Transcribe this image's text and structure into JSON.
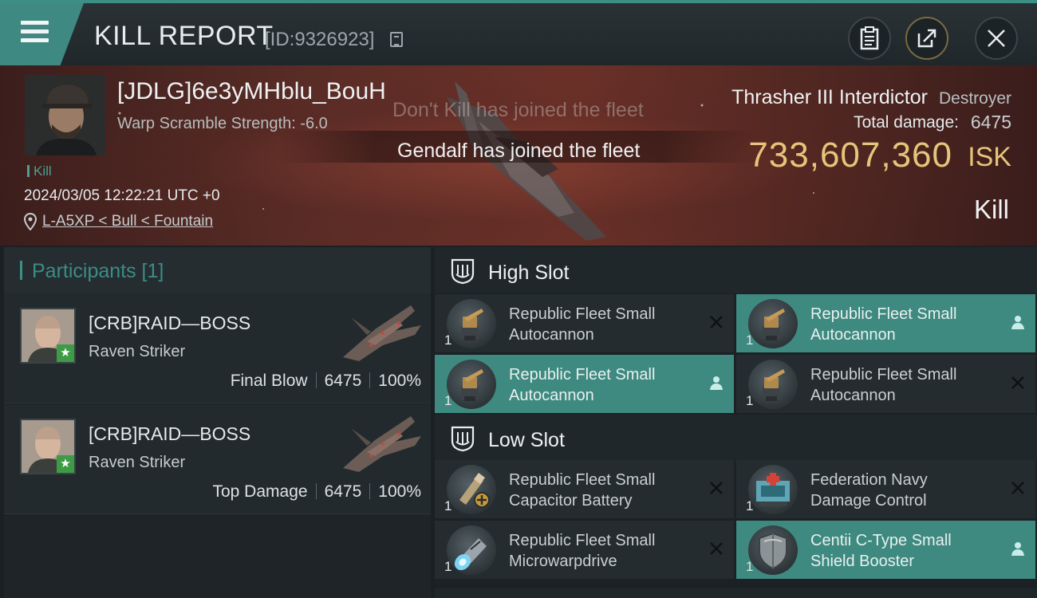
{
  "header": {
    "title": "KILL REPORT",
    "report_id": "[ID:9326923]"
  },
  "victim": {
    "name": "[JDLG]6e3yMHblu_BouH",
    "scramble_strength": "Warp Scramble Strength: -6.0",
    "tag": "Kill",
    "time": "2024/03/05 12:22:21 UTC +0",
    "location": "L-A5XP < Bull < Fountain"
  },
  "fleet_messages": [
    "Don't Kill has joined the fleet",
    "Gendalf has joined the fleet"
  ],
  "ship": {
    "name": "Thrasher III Interdictor",
    "class": "Destroyer",
    "total_damage_label": "Total damage:",
    "total_damage": "6475",
    "isk_value": "733,607,360",
    "isk_unit": "ISK",
    "result": "Kill"
  },
  "participants": {
    "title": "Participants [1]",
    "rows": [
      {
        "name": "[CRB]RAID—BOSS",
        "ship": "Raven Striker",
        "role": "Final Blow",
        "damage": "6475",
        "percent": "100%"
      },
      {
        "name": "[CRB]RAID—BOSS",
        "ship": "Raven Striker",
        "role": "Top Damage",
        "damage": "6475",
        "percent": "100%"
      }
    ]
  },
  "fitting": {
    "high_slot": {
      "title": "High Slot",
      "modules": [
        {
          "name_line1": "Republic Fleet Small",
          "name_line2": "Autocannon",
          "qty": "1",
          "state": "destroyed",
          "icon": "autocannon-icon"
        },
        {
          "name_line1": "Republic Fleet Small",
          "name_line2": "Autocannon",
          "qty": "1",
          "state": "dropped",
          "icon": "autocannon-icon"
        },
        {
          "name_line1": "Republic Fleet Small",
          "name_line2": "Autocannon",
          "qty": "1",
          "state": "dropped",
          "icon": "autocannon-icon"
        },
        {
          "name_line1": "Republic Fleet Small",
          "name_line2": "Autocannon",
          "qty": "1",
          "state": "destroyed",
          "icon": "autocannon-icon"
        }
      ]
    },
    "low_slot": {
      "title": "Low Slot",
      "modules": [
        {
          "name_line1": "Republic Fleet Small",
          "name_line2": "Capacitor Battery",
          "qty": "1",
          "state": "destroyed",
          "icon": "capacitor-battery-icon"
        },
        {
          "name_line1": "Federation Navy",
          "name_line2": "Damage Control",
          "qty": "1",
          "state": "destroyed",
          "icon": "damage-control-icon"
        },
        {
          "name_line1": "Republic Fleet Small",
          "name_line2": "Microwarpdrive",
          "qty": "1",
          "state": "destroyed",
          "icon": "microwarpdrive-icon"
        },
        {
          "name_line1": "Centii C-Type Small",
          "name_line2": "Shield Booster",
          "qty": "1",
          "state": "dropped",
          "icon": "shield-booster-icon"
        }
      ]
    }
  },
  "colors": {
    "accent_teal": "#3e8a80",
    "isk_gold": "#e6c57a",
    "kill_banner": "#5a2c26",
    "star_badge": "#3e9b45"
  }
}
